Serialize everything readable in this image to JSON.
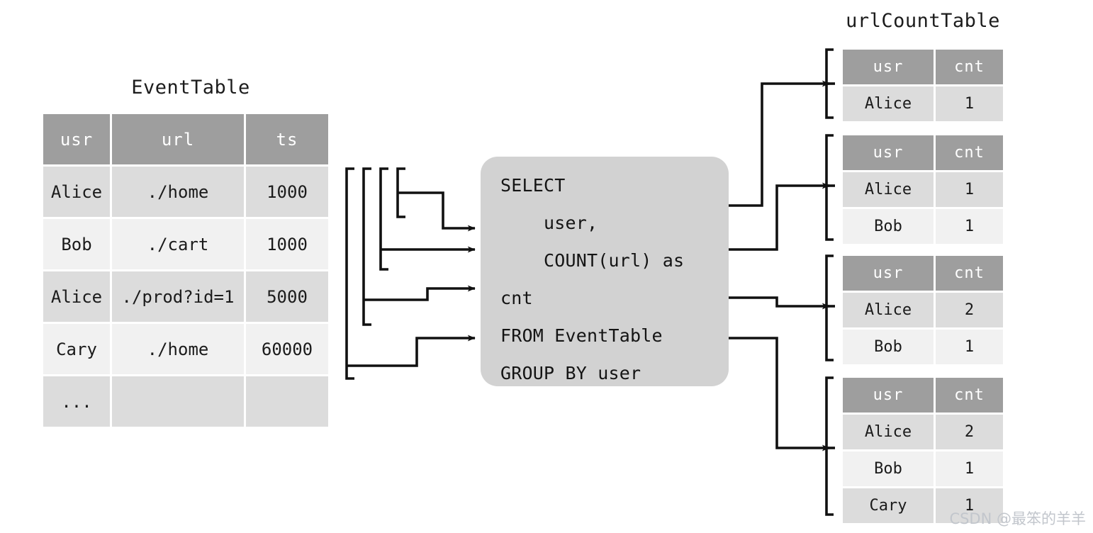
{
  "source_table": {
    "title": "EventTable",
    "columns": [
      "usr",
      "url",
      "ts"
    ],
    "rows": [
      [
        "Alice",
        "./home",
        "1000"
      ],
      [
        "Bob",
        "./cart",
        "1000"
      ],
      [
        "Alice",
        "./prod?id=1",
        "5000"
      ],
      [
        "Cary",
        "./home",
        "60000"
      ],
      [
        "...",
        "",
        ""
      ]
    ]
  },
  "query": {
    "lines": [
      "SELECT",
      "    user,",
      "    COUNT(url) as",
      "cnt",
      "FROM EventTable",
      "GROUP BY user"
    ]
  },
  "result_section": {
    "title": "urlCountTable",
    "columns": [
      "usr",
      "cnt"
    ],
    "tables": [
      {
        "rows": [
          [
            "Alice",
            "1"
          ]
        ]
      },
      {
        "rows": [
          [
            "Alice",
            "1"
          ],
          [
            "Bob",
            "1"
          ]
        ]
      },
      {
        "rows": [
          [
            "Alice",
            "2"
          ],
          [
            "Bob",
            "1"
          ]
        ]
      },
      {
        "rows": [
          [
            "Alice",
            "2"
          ],
          [
            "Bob",
            "1"
          ],
          [
            "Cary",
            "1"
          ]
        ]
      }
    ]
  },
  "watermark": "CSDN @最笨的羊羊",
  "colors": {
    "header_fill": "#9e9e9e",
    "header_text": "#ffffff",
    "row_dark": "#dcdcdc",
    "row_light": "#f1f1f1",
    "box_fill": "#d2d2d2",
    "wire": "#111111",
    "text": "#1b1b1b",
    "watermark": "#c2c6cc"
  }
}
